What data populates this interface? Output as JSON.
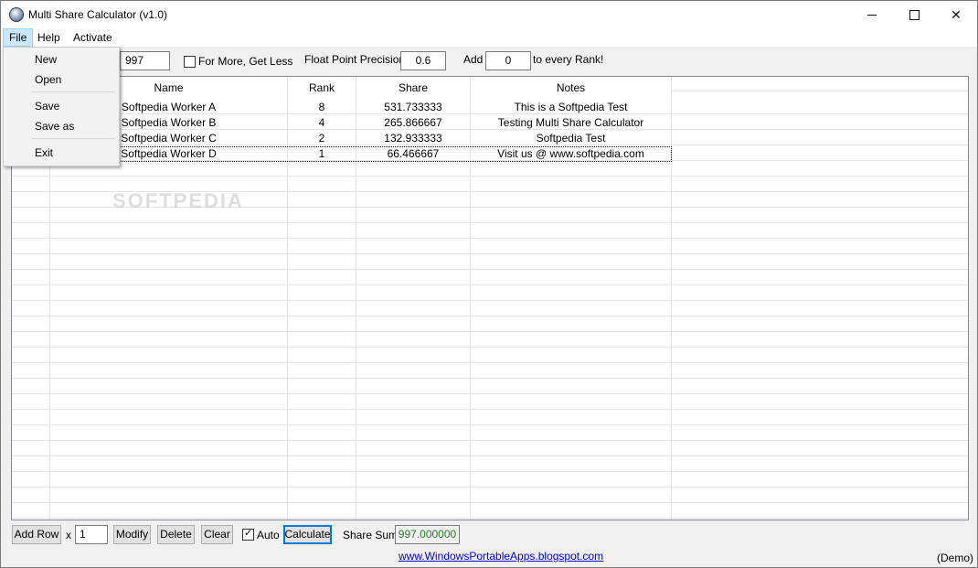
{
  "window": {
    "title": "Multi Share Calculator (v1.0)"
  },
  "menu": {
    "file": "File",
    "help": "Help",
    "activate": "Activate"
  },
  "file_menu": {
    "new": "New",
    "open": "Open",
    "save": "Save",
    "save_as": "Save as",
    "exit": "Exit"
  },
  "toolbar": {
    "total_value": "997",
    "for_more_label": "For More, Get Less",
    "for_more_checked": false,
    "precision_label": "Float Point Precision:",
    "precision_value": "0.6",
    "add_label": "Add",
    "add_value": "0",
    "every_rank_label": "to every Rank!"
  },
  "table": {
    "columns": [
      "Name",
      "Rank",
      "Share",
      "Notes"
    ],
    "rows": [
      {
        "name": "Softpedia Worker A",
        "rank": "8",
        "share": "531.733333",
        "notes": "This is a Softpedia Test"
      },
      {
        "name": "Softpedia Worker B",
        "rank": "4",
        "share": "265.866667",
        "notes": "Testing Multi Share Calculator"
      },
      {
        "name": "Softpedia Worker C",
        "rank": "2",
        "share": "132.933333",
        "notes": "Softpedia Test"
      },
      {
        "name": "Softpedia Worker D",
        "rank": "1",
        "share": "66.466667",
        "notes": "Visit us @ www.softpedia.com"
      }
    ]
  },
  "bottom": {
    "add_row": "Add Row",
    "x_label": "x",
    "row_count": "1",
    "modify": "Modify",
    "delete": "Delete",
    "clear": "Clear",
    "auto_label": "Auto",
    "auto_checked": true,
    "calculate": "Calculate",
    "share_sum_label": "Share Sum",
    "share_sum_value": "997.000000",
    "link": "www.WindowsPortableApps.blogspot.com",
    "demo": "(Demo)"
  },
  "colors": {
    "accent": "#0078d7",
    "sum_text": "#2a7a2a",
    "link": "#0000ee",
    "menu_highlight": "#cce8ff"
  }
}
